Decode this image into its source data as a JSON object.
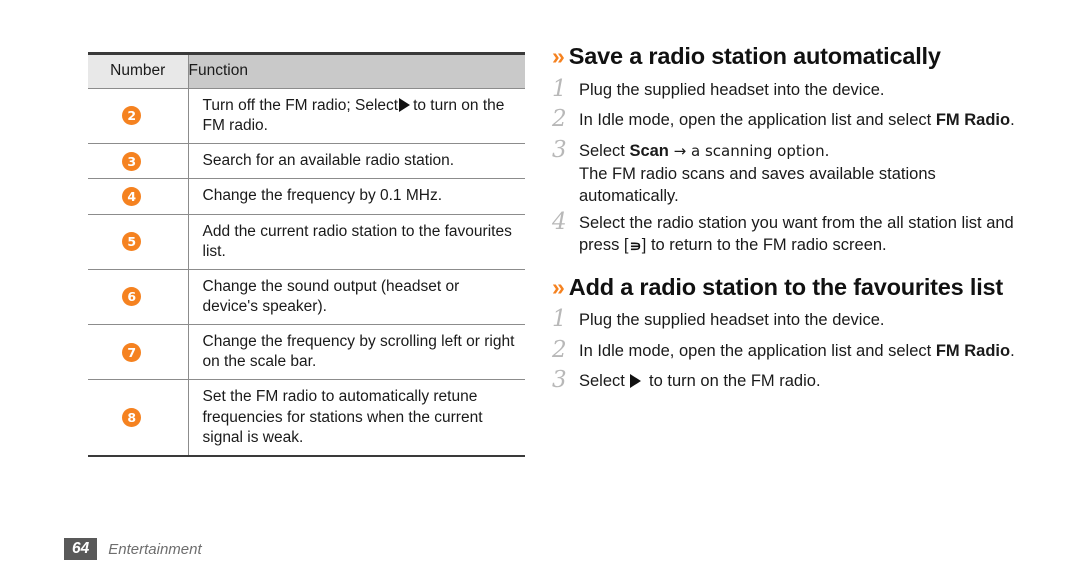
{
  "table": {
    "headers": [
      "Number",
      "Function"
    ],
    "rows": [
      {
        "number": "2",
        "text_before": "Turn off the FM radio; Select",
        "icon": "play-icon",
        "text_after": "to turn on the FM radio."
      },
      {
        "number": "3",
        "text_before": "Search for an available radio station.",
        "icon": "",
        "text_after": ""
      },
      {
        "number": "4",
        "text_before": "Change the frequency by 0.1 MHz.",
        "icon": "",
        "text_after": ""
      },
      {
        "number": "5",
        "text_before": "Add the current radio station to the favourites list.",
        "icon": "",
        "text_after": ""
      },
      {
        "number": "6",
        "text_before": "Change the sound output (headset or device's speaker).",
        "icon": "",
        "text_after": ""
      },
      {
        "number": "7",
        "text_before": "Change the frequency by scrolling left or right on the scale bar.",
        "icon": "",
        "text_after": ""
      },
      {
        "number": "8",
        "text_before": "Set the FM radio to automatically retune frequencies for stations when the current signal is weak.",
        "icon": "",
        "text_after": ""
      }
    ]
  },
  "sections": [
    {
      "marker": "»",
      "title": "Save a radio station automatically",
      "steps": [
        {
          "num": "1",
          "pre": "Plug the supplied headset into the device.",
          "bold": "",
          "post": "",
          "note": ""
        },
        {
          "num": "2",
          "pre": "In Idle mode, open the application list and select ",
          "bold": "FM Radio",
          "post": ".",
          "note": ""
        },
        {
          "num": "3",
          "pre": "Select ",
          "bold": "Scan",
          "post": " → a scanning option.",
          "note": "The FM radio scans and saves available stations automatically."
        },
        {
          "num": "4",
          "pre": "Select the radio station you want from the all station list and press [",
          "bold": "",
          "post": "] to return to the FM radio screen.",
          "note": "",
          "inline_icon": "back-key-icon"
        }
      ]
    },
    {
      "marker": "»",
      "title": "Add a radio station to the favourites list",
      "steps": [
        {
          "num": "1",
          "pre": "Plug the supplied headset into the device.",
          "bold": "",
          "post": "",
          "note": ""
        },
        {
          "num": "2",
          "pre": "In Idle mode, open the application list and select ",
          "bold": "FM Radio",
          "post": ".",
          "note": ""
        },
        {
          "num": "3",
          "pre": "Select ",
          "bold": "",
          "post": " to turn on the FM radio.",
          "note": "",
          "inline_icon": "play-icon"
        }
      ]
    }
  ],
  "footer": {
    "page_number": "64",
    "chapter": "Entertainment"
  },
  "colors": {
    "accent_orange": "#f58220",
    "header_number_bg": "#e8e8e8",
    "header_function_bg": "#c9c9c9",
    "footer_badge_bg": "#595959"
  }
}
